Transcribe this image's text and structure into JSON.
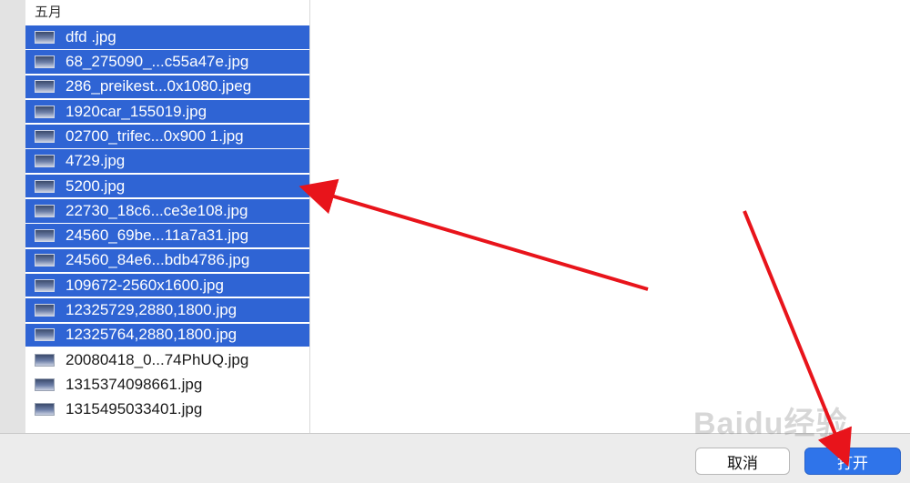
{
  "sidebar": {
    "group_header": "五月",
    "files": [
      {
        "name": "dfd .jpg",
        "selected": true
      },
      {
        "name": "68_275090_...c55a47e.jpg",
        "selected": true
      },
      {
        "name": "286_preikest...0x1080.jpeg",
        "selected": true
      },
      {
        "name": "1920car_155019.jpg",
        "selected": true
      },
      {
        "name": "02700_trifec...0x900 1.jpg",
        "selected": true
      },
      {
        "name": "4729.jpg",
        "selected": true
      },
      {
        "name": "5200.jpg",
        "selected": true
      },
      {
        "name": "22730_18c6...ce3e108.jpg",
        "selected": true
      },
      {
        "name": "24560_69be...11a7a31.jpg",
        "selected": true
      },
      {
        "name": "24560_84e6...bdb4786.jpg",
        "selected": true
      },
      {
        "name": "109672-2560x1600.jpg",
        "selected": true
      },
      {
        "name": "12325729,2880,1800.jpg",
        "selected": true
      },
      {
        "name": "12325764,2880,1800.jpg",
        "selected": true
      },
      {
        "name": "20080418_0...74PhUQ.jpg",
        "selected": false
      },
      {
        "name": "1315374098661.jpg",
        "selected": false
      },
      {
        "name": "1315495033401.jpg",
        "selected": false
      }
    ]
  },
  "buttons": {
    "cancel_label": "取消",
    "open_label": "打开"
  },
  "watermark": "Baidu 经验",
  "colors": {
    "selection": "#2f64d4",
    "primary_button": "#2f74ea",
    "annotation_arrow": "#e8141b"
  }
}
